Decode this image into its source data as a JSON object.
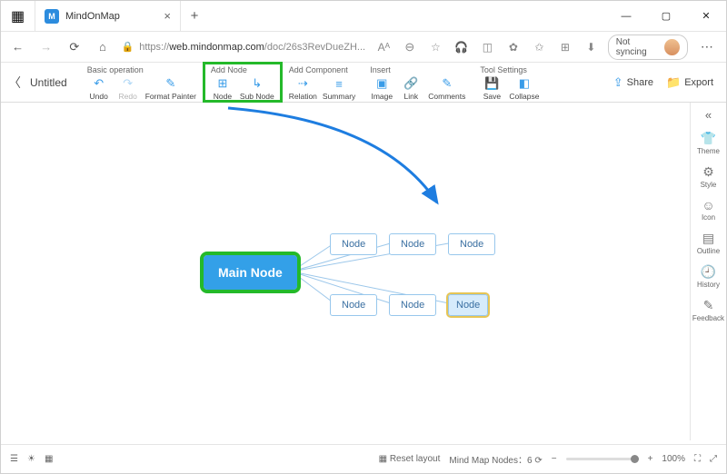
{
  "browser": {
    "tab_title": "MindOnMap",
    "url_prefix": "https://",
    "url_host": "web.mindonmap.com",
    "url_path": "/doc/26s3RevDueZH...",
    "sync_label": "Not syncing"
  },
  "toolbar": {
    "doc_title": "Untitled",
    "groups": {
      "basic": {
        "label": "Basic operation",
        "undo": "Undo",
        "redo": "Redo",
        "fp": "Format Painter"
      },
      "addnode": {
        "label": "Add Node",
        "node": "Node",
        "sub": "Sub Node"
      },
      "addcomp": {
        "label": "Add Component",
        "rel": "Relation",
        "sum": "Summary"
      },
      "insert": {
        "label": "Insert",
        "img": "Image",
        "link": "Link",
        "com": "Comments"
      },
      "tools": {
        "label": "Tool Settings",
        "save": "Save",
        "col": "Collapse"
      }
    },
    "share": "Share",
    "export": "Export"
  },
  "canvas": {
    "main": "Main Node",
    "children": [
      "Node",
      "Node",
      "Node",
      "Node",
      "Node",
      "Node"
    ]
  },
  "sidepanel": {
    "theme": "Theme",
    "style": "Style",
    "icon": "Icon",
    "outline": "Outline",
    "history": "History",
    "feedback": "Feedback"
  },
  "statusbar": {
    "reset": "Reset layout",
    "nodes_label": "Mind Map Nodes",
    "nodes_count": "6",
    "zoom": "100%"
  }
}
